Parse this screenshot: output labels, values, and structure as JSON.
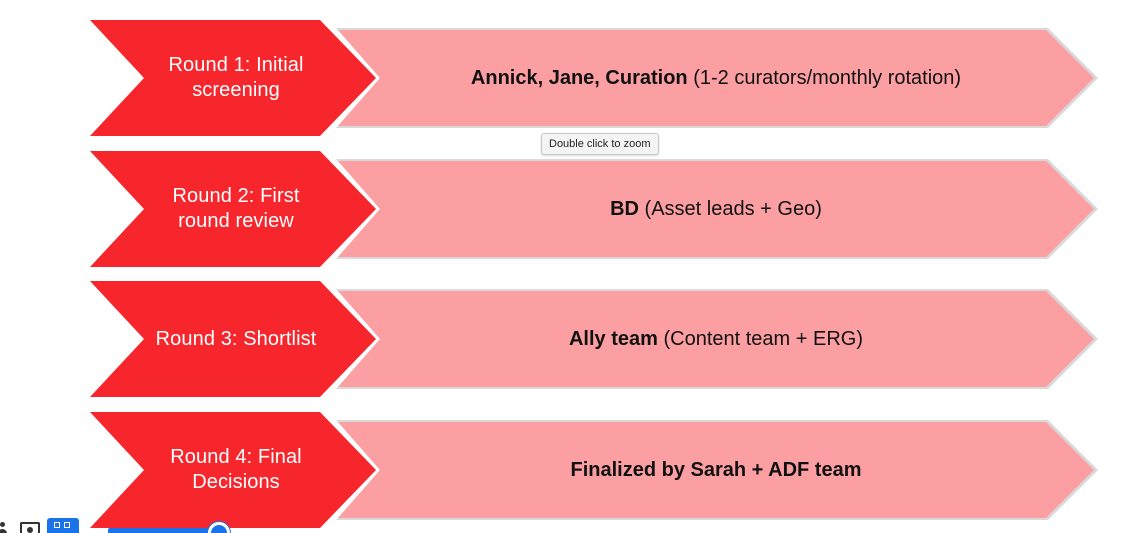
{
  "tooltip": {
    "text": "Double click to zoom"
  },
  "rounds": [
    {
      "label_lines": [
        "Round 1: Initial",
        "screening"
      ],
      "bold": "Annick, Jane, Curation",
      "normal": " (1-2 curators/monthly rotation)"
    },
    {
      "label_lines": [
        "Round 2: First",
        "round review"
      ],
      "bold": "BD",
      "normal": " (Asset leads + Geo)"
    },
    {
      "label_lines": [
        "Round 3: Shortlist"
      ],
      "bold": "Ally team",
      "normal": " (Content team + ERG)"
    },
    {
      "label_lines": [
        "Round 4: Final",
        "Decisions"
      ],
      "bold": "Finalized by Sarah + ADF team",
      "normal": ""
    }
  ],
  "colors": {
    "chevron": "#f7262c",
    "arrow": "#fc9fa2",
    "accent_blue": "#1a73e8"
  },
  "toolbar": {
    "icons": [
      "person-icon",
      "camera-icon",
      "grid-view-icon",
      "progress-slider"
    ]
  }
}
